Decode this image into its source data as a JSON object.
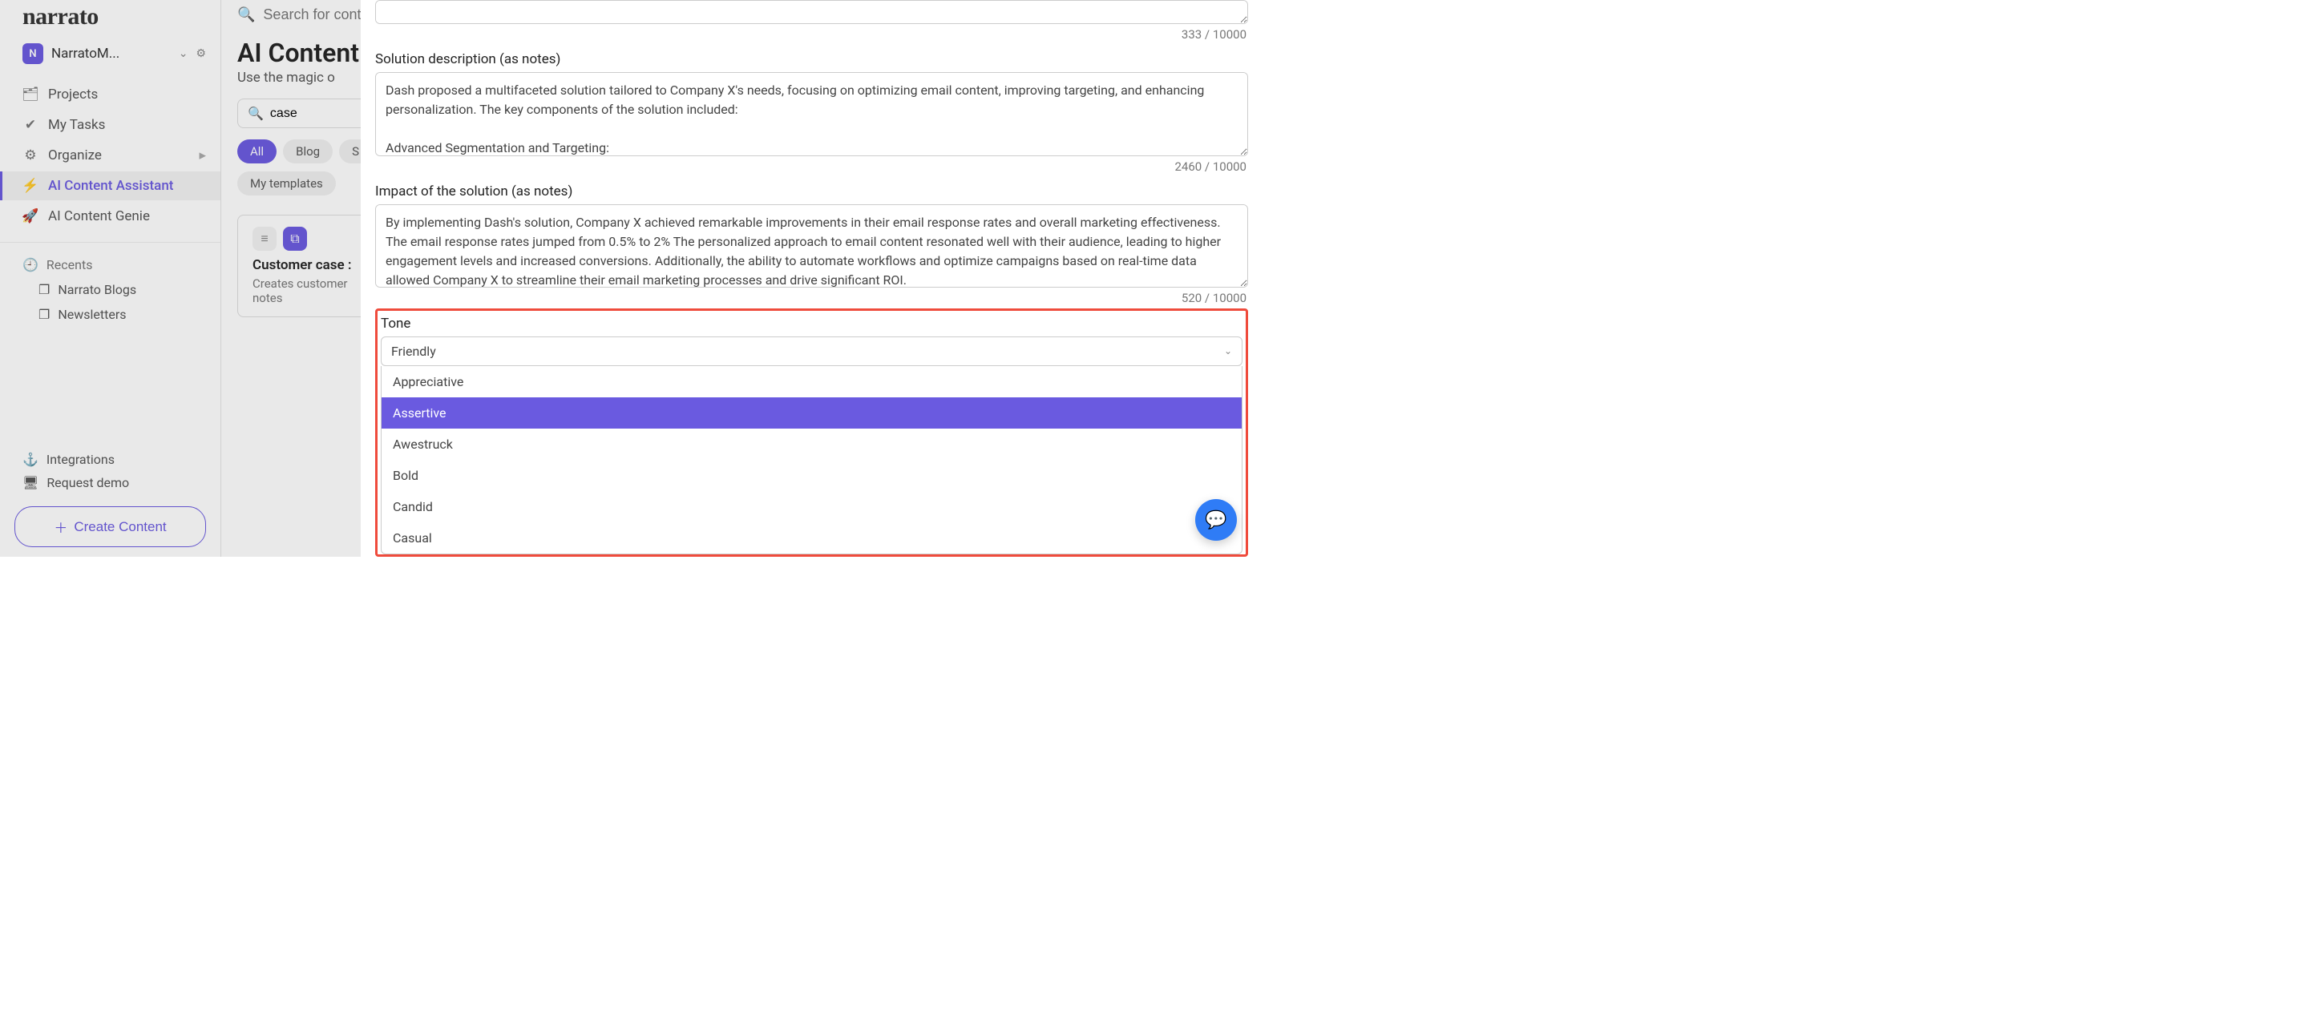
{
  "brand": "narrato",
  "workspace": {
    "badge": "N",
    "name": "NarratoM..."
  },
  "nav": {
    "projects": "Projects",
    "tasks": "My Tasks",
    "organize": "Organize",
    "assistant": "AI Content Assistant",
    "genie": "AI Content Genie"
  },
  "recents": {
    "label": "Recents",
    "items": [
      "Narrato Blogs",
      "Newsletters"
    ]
  },
  "bottom": {
    "integrations": "Integrations",
    "demo": "Request demo",
    "create": "Create Content"
  },
  "search": {
    "placeholder": "Search for cont"
  },
  "page": {
    "title": "AI Content",
    "subtitle": "Use the magic o"
  },
  "filter": {
    "value": "case"
  },
  "pills": {
    "all": "All",
    "blog": "Blog",
    "s": "S",
    "templates": "My templates"
  },
  "card": {
    "title": "Customer case :",
    "desc": "Creates customer",
    "desc2": "notes"
  },
  "panel": {
    "counter0": "333 / 10000",
    "solution_label": "Solution description (as notes)",
    "solution_value": "Dash proposed a multifaceted solution tailored to Company X's needs, focusing on optimizing email content, improving targeting, and enhancing personalization. The key components of the solution included:\n\nAdvanced Segmentation and Targeting:",
    "counter1": "2460 / 10000",
    "impact_label": "Impact of the solution (as notes)",
    "impact_value": "By implementing Dash's solution, Company X achieved remarkable improvements in their email response rates and overall marketing effectiveness. The email response rates jumped from 0.5% to 2% The personalized approach to email content resonated well with their audience, leading to higher engagement levels and increased conversions. Additionally, the ability to automate workflows and optimize campaigns based on real-time data allowed Company X to streamline their email marketing processes and drive significant ROI.",
    "counter2": "520 / 10000",
    "tone_label": "Tone",
    "tone_selected": "Friendly",
    "tone_options": [
      "Appreciative",
      "Assertive",
      "Awestruck",
      "Bold",
      "Candid",
      "Casual"
    ],
    "tone_highlight": "Assertive"
  }
}
